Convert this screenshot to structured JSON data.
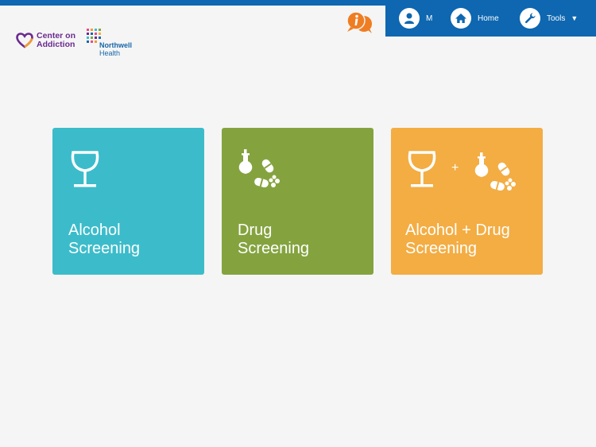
{
  "header": {
    "user_label": "M",
    "home_label": "Home",
    "tools_label": "Tools"
  },
  "logo": {
    "coa_line1": "Center on",
    "coa_line2": "Addiction",
    "northwell_line1": "Northwell",
    "northwell_line2": "Health"
  },
  "tiles": [
    {
      "line1": "Alcohol",
      "line2": "Screening"
    },
    {
      "line1": "Drug",
      "line2": "Screening"
    },
    {
      "line1": "Alcohol + Drug",
      "line2": "Screening"
    }
  ],
  "combo_plus": "+",
  "colors": {
    "nav": "#0e67b0",
    "alcohol_tile": "#3cbcca",
    "drug_tile": "#84a33f",
    "combo_tile": "#f3ad43",
    "info_icon": "#ef7d22",
    "logo_purple": "#6a2a8e",
    "logo_blue": "#1767a8"
  },
  "icons": {
    "info": "info-chat-icon",
    "user": "user-icon",
    "home": "home-icon",
    "tools": "wrench-icon",
    "alcohol": "wine-glass-icon",
    "drug": "flask-pills-icon"
  }
}
